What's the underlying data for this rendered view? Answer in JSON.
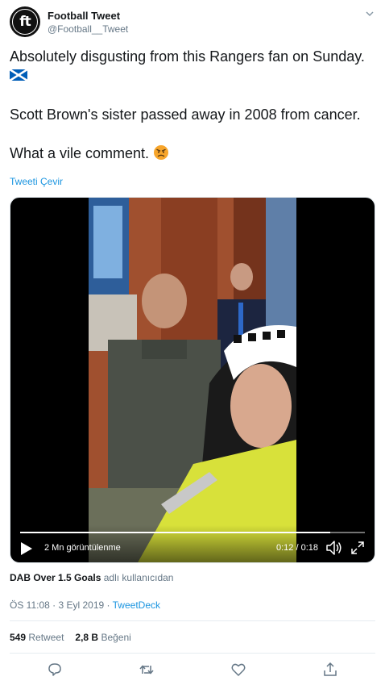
{
  "user": {
    "display_name": "Football Tweet",
    "handle": "@Football__Tweet",
    "avatar_text": "ft"
  },
  "tweet": {
    "line1": "Absolutely disgusting from this Rangers fan on Sunday.",
    "line2": "Scott Brown's sister passed away in 2008 from cancer.",
    "line3": "What a vile comment.",
    "translate_label": "Tweeti Çevir"
  },
  "video": {
    "views_label": "2 Mn görüntülenme",
    "time_label": "0:12 / 0:18",
    "progress": 0.9
  },
  "attribution": {
    "user": "DAB Over 1.5 Goals",
    "suffix": "adlı kullanıcıdan"
  },
  "meta": {
    "timestamp": "ÖS 11:08 · 3 Eyl 2019 ·",
    "source": "TweetDeck"
  },
  "stats": {
    "retweets_count": "549",
    "retweets_label": "Retweet",
    "likes_count": "2,8 B",
    "likes_label": "Beğeni"
  },
  "colors": {
    "accent": "#1b95e0",
    "muted": "#657786",
    "text": "#14171a"
  },
  "icons": [
    "chevron-down-icon",
    "scotland-flag-icon",
    "angry-face-icon",
    "play-icon",
    "volume-icon",
    "fullscreen-icon",
    "reply-icon",
    "retweet-icon",
    "like-icon",
    "share-icon"
  ]
}
